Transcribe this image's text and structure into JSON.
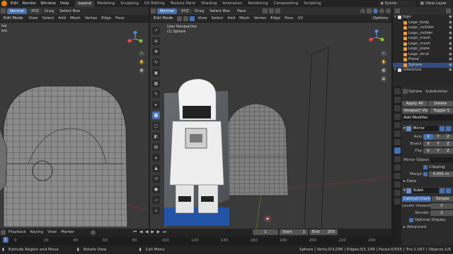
{
  "topbar": {
    "menus": [
      "Edit",
      "Render",
      "Window",
      "Help"
    ],
    "workspaces": [
      "Layout",
      "Modeling",
      "Sculpting",
      "UV Editing",
      "Texture Paint",
      "Shading",
      "Animation",
      "Rendering",
      "Compositing",
      "Scripting"
    ],
    "active_workspace": "Layout",
    "scene_label": "Scene",
    "view_layer_label": "View Layer"
  },
  "left_viewport": {
    "header": {
      "orientation": "Normal",
      "xyz": "XYZ",
      "drag": "Drag",
      "select_box": "Select Box"
    },
    "mode": "Edit Mode",
    "menus": [
      "View",
      "Select",
      "Add",
      "Mesh",
      "Vertex",
      "Edge",
      "Face"
    ],
    "info_line1": "ive",
    "info_line2": "ere"
  },
  "mid_viewport": {
    "header": {
      "orientation": "Normal",
      "xyz": "XYZ",
      "drag": "Drag",
      "select_box": "Select Box",
      "pivot": "Face"
    },
    "mode": "Edit Mode",
    "menus": [
      "View",
      "Select",
      "Add",
      "Mesh",
      "Vertex",
      "Edge",
      "Face",
      "UV"
    ],
    "info_line1": "User Perspective",
    "info_line2": "(1) Sphere",
    "options_label": "Options"
  },
  "outliner": {
    "rows": [
      {
        "label": "logo",
        "indent": 0,
        "selected": false
      },
      {
        "label": "Lego_body",
        "indent": 1,
        "selected": false
      },
      {
        "label": "Lego_collider",
        "indent": 1,
        "selected": false
      },
      {
        "label": "Lego_colider",
        "indent": 1,
        "selected": false
      },
      {
        "label": "Lego_mesh",
        "indent": 1,
        "selected": false
      },
      {
        "label": "Lego_mesh",
        "indent": 1,
        "selected": false
      },
      {
        "label": "Lego_plate",
        "indent": 1,
        "selected": false
      },
      {
        "label": "Lego_strut",
        "indent": 1,
        "selected": false
      },
      {
        "label": "Plane",
        "indent": 1,
        "selected": false
      },
      {
        "label": "Sphere",
        "indent": 1,
        "selected": true
      },
      {
        "label": "reference",
        "indent": 0,
        "selected": false
      }
    ]
  },
  "properties": {
    "object_name": "Sphere",
    "modifier_name": "Subdivision",
    "apply_label": "Apply All",
    "delete_label": "Delete",
    "viewport_vis_label": "Viewport Vis",
    "toggle_label": "Toggle S",
    "add_modifier_label": "Add Modifier",
    "mirror": {
      "name": "Mirror",
      "axis_label": "Axis",
      "bisect_label": "Bisect",
      "flip_label": "Flip",
      "axes": [
        "X",
        "Y",
        "Z"
      ],
      "mirror_object_label": "Mirror Object",
      "clipping_label": "Clipping",
      "merge_label": "Merge",
      "merge_value": "0.001 m",
      "data_label": "Data"
    },
    "subd": {
      "name": "Subd",
      "catmull_label": "Catmull-Clark",
      "simple_label": "Simple",
      "levels_label": "Levels Viewport",
      "levels_value": "2",
      "render_label": "Render",
      "render_value": "2",
      "optimal_label": "Optimal Display",
      "advanced_label": "Advanced"
    }
  },
  "timeline": {
    "menus": [
      "Playback",
      "Keying",
      "View",
      "Marker"
    ],
    "current_frame": "1",
    "start_label": "Start",
    "start_value": "1",
    "end_label": "End",
    "end_value": "250",
    "ticks": [
      "0",
      "20",
      "40",
      "60",
      "80",
      "100",
      "120",
      "140",
      "160",
      "180",
      "200",
      "220",
      "240"
    ]
  },
  "statusbar": {
    "hint1": "Extrude Region and Move",
    "hint2": "Rotate View",
    "hint3": "Call Menu",
    "stats": "Sphere | Verts:0/3,096 | Edges:0/1,149 | Faces:0/555 | Tris:1,097 | Objects:1/6"
  },
  "colors": {
    "accent": "#4772b3",
    "bg": "#1d1d1d",
    "viewport": "#3a3a3a",
    "axis_x": "#e54e4e",
    "axis_y": "#8ac43d",
    "axis_z": "#4c8ddd"
  }
}
